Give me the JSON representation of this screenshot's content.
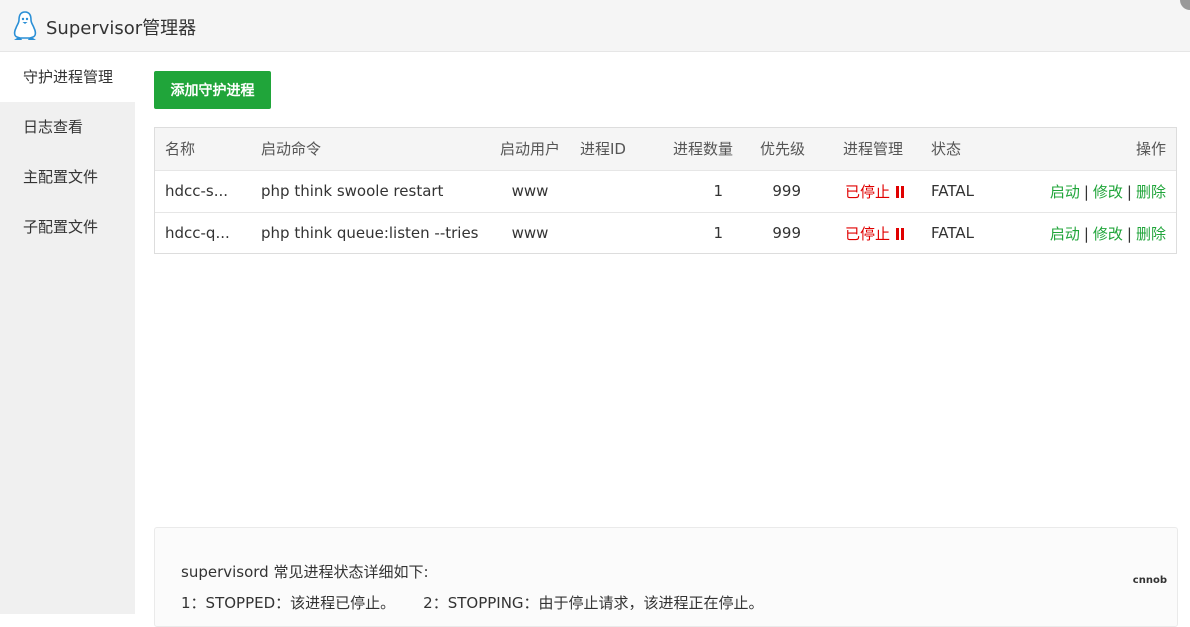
{
  "app": {
    "title": "Supervisor管理器",
    "logo_icon": "penguin-icon"
  },
  "sidebar": {
    "items": [
      {
        "label": "守护进程管理",
        "active": true
      },
      {
        "label": "日志查看",
        "active": false
      },
      {
        "label": "主配置文件",
        "active": false
      },
      {
        "label": "子配置文件",
        "active": false
      }
    ]
  },
  "toolbar": {
    "add_label": "添加守护进程"
  },
  "table": {
    "headers": {
      "name": "名称",
      "command": "启动命令",
      "user": "启动用户",
      "pid": "进程ID",
      "count": "进程数量",
      "priority": "优先级",
      "manage": "进程管理",
      "status": "状态",
      "actions": "操作"
    },
    "rows": [
      {
        "name": "hdcc-s...",
        "command": "php think swoole restart",
        "user": "www",
        "pid": "",
        "count": "1",
        "priority": "999",
        "manage": "已停止",
        "status": "FATAL",
        "start": "启动",
        "edit": "修改",
        "delete": "删除"
      },
      {
        "name": "hdcc-q...",
        "command": "php think queue:listen --tries",
        "user": "www",
        "pid": "",
        "count": "1",
        "priority": "999",
        "manage": "已停止",
        "status": "FATAL",
        "start": "启动",
        "edit": "修改",
        "delete": "删除"
      }
    ]
  },
  "info": {
    "title": "supervisord 常见进程状态详细如下:",
    "line1a": "1：STOPPED：该进程已停止。",
    "line1b": "2：STOPPING：由于停止请求，该进程正在停止。",
    "watermark": "cnnob"
  },
  "colors": {
    "accent": "#20a53a",
    "stopped": "#e00000"
  }
}
